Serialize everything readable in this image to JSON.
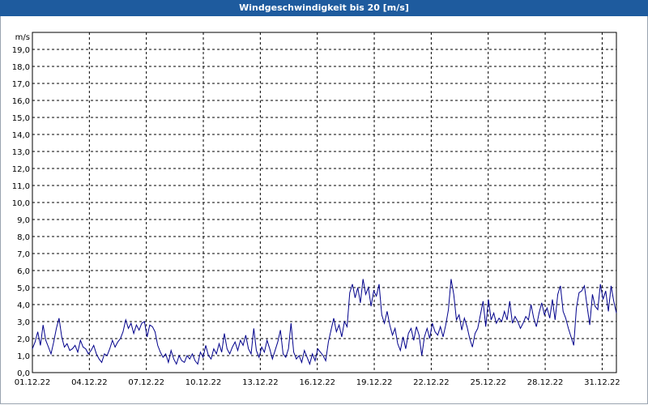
{
  "window": {
    "title": "Windgeschwindigkeit bis 20 [m/s]"
  },
  "colors": {
    "titlebar": "#1e5b9e",
    "series": "#00008b",
    "grid": "#000000"
  },
  "chart_data": {
    "type": "line",
    "title": "Windgeschwindigkeit bis 20 [m/s]",
    "ylabel": "m/s",
    "xlabel": "",
    "ylim": [
      0,
      20
    ],
    "xlim_days": [
      0,
      30.75
    ],
    "grid": true,
    "yticks": [
      "0,0",
      "1,0",
      "2,0",
      "3,0",
      "4,0",
      "5,0",
      "6,0",
      "7,0",
      "8,0",
      "9,0",
      "10,0",
      "11,0",
      "12,0",
      "13,0",
      "14,0",
      "15,0",
      "16,0",
      "17,0",
      "18,0",
      "19,0"
    ],
    "ytick_values": [
      0,
      1,
      2,
      3,
      4,
      5,
      6,
      7,
      8,
      9,
      10,
      11,
      12,
      13,
      14,
      15,
      16,
      17,
      18,
      19
    ],
    "xticks": [
      "01.12.22",
      "04.12.22",
      "07.12.22",
      "10.12.22",
      "13.12.22",
      "16.12.22",
      "19.12.22",
      "22.12.22",
      "25.12.22",
      "28.12.22",
      "31.12.22"
    ],
    "xtick_days": [
      0,
      3,
      6,
      9,
      12,
      15,
      18,
      21,
      24,
      27,
      30
    ],
    "series": [
      {
        "name": "",
        "day": [
          0,
          0.2,
          0.4,
          0.6,
          0.8,
          1,
          1.2,
          1.4,
          1.6,
          1.8,
          2,
          2.2,
          2.4,
          2.6,
          2.8,
          3,
          3.2,
          3.4,
          3.6,
          3.8,
          4,
          4.2,
          4.4,
          4.6,
          4.8,
          5,
          5.2,
          5.4,
          5.6,
          5.8,
          6,
          6.2,
          6.4,
          6.6,
          6.8,
          7,
          7.2,
          7.4,
          7.6,
          7.8,
          8,
          8.2,
          8.4,
          8.6,
          8.8,
          9,
          9.2,
          9.4,
          9.6,
          9.8,
          10,
          10.2,
          10.4,
          10.6,
          10.8,
          11,
          11.2,
          11.4,
          11.6,
          11.8,
          12,
          12.2,
          12.4,
          12.6,
          12.8,
          13,
          13.2,
          13.4,
          13.6,
          13.8,
          14,
          14.2,
          14.4,
          14.6,
          14.8,
          15,
          15.2,
          15.4,
          15.6,
          15.8,
          16,
          16.2,
          16.4,
          16.6,
          16.8,
          17,
          17.2,
          17.4,
          17.6,
          17.8,
          18,
          18.2,
          18.4,
          18.6,
          18.8,
          19,
          19.2,
          19.4,
          19.6,
          19.8,
          20,
          20.2,
          20.4,
          20.6,
          20.8,
          21,
          21.2,
          21.4,
          21.6,
          21.8,
          22,
          22.2,
          22.4,
          22.6,
          22.8,
          23,
          23.2,
          23.4,
          23.6,
          23.8,
          24,
          24.2,
          24.4,
          24.6,
          24.8,
          25,
          25.2,
          25.4,
          25.6,
          25.8,
          26,
          26.2,
          26.4,
          26.6,
          26.8,
          27,
          27.2,
          27.4,
          27.6,
          27.8,
          28,
          28.2,
          28.4,
          28.6,
          28.8,
          29,
          29.2,
          29.4,
          29.6,
          29.8,
          30,
          30.2,
          30.4,
          30.6,
          30.75
        ],
        "values": [
          1.4,
          1.8,
          2.4,
          1.6,
          2.8,
          1.9,
          1.5,
          1.1,
          1.8,
          2.6,
          3.2,
          2.1,
          1.5,
          1.7,
          1.3,
          1.4,
          1.6,
          1.2,
          1.9,
          1.5,
          1.4,
          1.1,
          1.3,
          1.6,
          1.1,
          0.8,
          0.6,
          1.1,
          1.0,
          1.4,
          1.9,
          1.5,
          1.8,
          2.0,
          2.4,
          3.1,
          2.6,
          2.9,
          2.3,
          2.8,
          2.5,
          2.9,
          3.0,
          2.1,
          2.8,
          2.7,
          2.4,
          1.6,
          1.2,
          0.9,
          1.1,
          0.6,
          1.3,
          0.8,
          0.5,
          1.0,
          0.7,
          0.6,
          1.0,
          0.8,
          1.1,
          0.7,
          0.5,
          1.2,
          0.9,
          1.6,
          1.0,
          0.8,
          1.4,
          1.1,
          1.7,
          1.2,
          2.3,
          1.4,
          1.1,
          1.5,
          1.8,
          1.3,
          1.9,
          1.6,
          2.2,
          1.4,
          1.1,
          2.6,
          1.3,
          0.9,
          1.5,
          1.2,
          1.9,
          1.4,
          0.8,
          1.3,
          1.8,
          2.5,
          1.1,
          0.9,
          1.4,
          2.9,
          1.2,
          0.8,
          1.0,
          0.6,
          1.3,
          0.9,
          0.5,
          1.1,
          0.7,
          1.4,
          1.2,
          1.0,
          0.7,
          1.8,
          2.5,
          3.2,
          2.4,
          2.8,
          2.1,
          3.0,
          2.7,
          4.7,
          5.2,
          4.4,
          5.0,
          4.1,
          5.5,
          4.6,
          5.0,
          3.9,
          4.8,
          4.5,
          5.2,
          3.4,
          2.9,
          3.6,
          2.8,
          2.2,
          2.6,
          1.7,
          1.3,
          2.1,
          1.4,
          2.3,
          2.6,
          1.9,
          2.7,
          2.2,
          1.0,
          2.1,
          2.6,
          2.0,
          2.9,
          2.4,
          2.2,
          2.7,
          2.1,
          2.8,
          3.7,
          5.5,
          4.6,
          3.1,
          3.4,
          2.5,
          3.2,
          2.7,
          2.0,
          1.5,
          2.3,
          2.6,
          3.4,
          4.2,
          2.7,
          4.3,
          3.1,
          3.5,
          2.9,
          3.2,
          3.0,
          3.6,
          3.1,
          4.2,
          2.9,
          3.3,
          3.0,
          2.6,
          2.9,
          3.3,
          3.1,
          4.0,
          3.2,
          2.7,
          3.5,
          4.1,
          3.4,
          3.8,
          3.2,
          4.3,
          3.1,
          4.6,
          5.1,
          3.6,
          3.2,
          2.6,
          2.1,
          1.6,
          3.8,
          4.7,
          4.8,
          5.1,
          3.9,
          2.8,
          4.6,
          3.9,
          3.7,
          5.2,
          4.3,
          4.8,
          3.6,
          5.1,
          4.2,
          3.5
        ]
      }
    ]
  }
}
